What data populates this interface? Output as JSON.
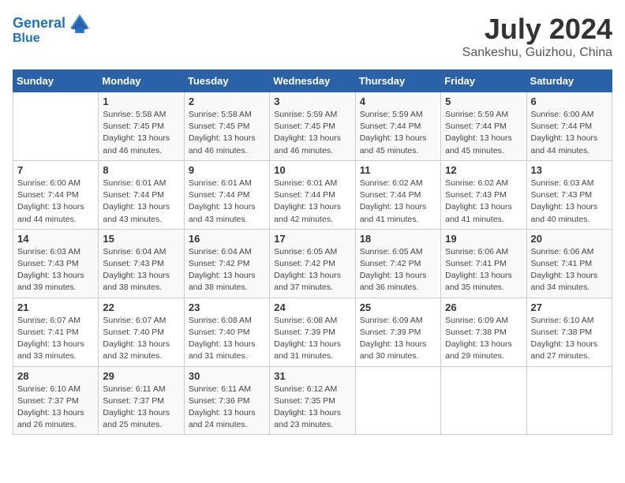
{
  "header": {
    "logo_line1": "General",
    "logo_line2": "Blue",
    "month_year": "July 2024",
    "location": "Sankeshu, Guizhou, China"
  },
  "weekdays": [
    "Sunday",
    "Monday",
    "Tuesday",
    "Wednesday",
    "Thursday",
    "Friday",
    "Saturday"
  ],
  "weeks": [
    [
      {
        "day": "",
        "info": ""
      },
      {
        "day": "1",
        "info": "Sunrise: 5:58 AM\nSunset: 7:45 PM\nDaylight: 13 hours\nand 46 minutes."
      },
      {
        "day": "2",
        "info": "Sunrise: 5:58 AM\nSunset: 7:45 PM\nDaylight: 13 hours\nand 46 minutes."
      },
      {
        "day": "3",
        "info": "Sunrise: 5:59 AM\nSunset: 7:45 PM\nDaylight: 13 hours\nand 46 minutes."
      },
      {
        "day": "4",
        "info": "Sunrise: 5:59 AM\nSunset: 7:44 PM\nDaylight: 13 hours\nand 45 minutes."
      },
      {
        "day": "5",
        "info": "Sunrise: 5:59 AM\nSunset: 7:44 PM\nDaylight: 13 hours\nand 45 minutes."
      },
      {
        "day": "6",
        "info": "Sunrise: 6:00 AM\nSunset: 7:44 PM\nDaylight: 13 hours\nand 44 minutes."
      }
    ],
    [
      {
        "day": "7",
        "info": "Sunrise: 6:00 AM\nSunset: 7:44 PM\nDaylight: 13 hours\nand 44 minutes."
      },
      {
        "day": "8",
        "info": "Sunrise: 6:01 AM\nSunset: 7:44 PM\nDaylight: 13 hours\nand 43 minutes."
      },
      {
        "day": "9",
        "info": "Sunrise: 6:01 AM\nSunset: 7:44 PM\nDaylight: 13 hours\nand 43 minutes."
      },
      {
        "day": "10",
        "info": "Sunrise: 6:01 AM\nSunset: 7:44 PM\nDaylight: 13 hours\nand 42 minutes."
      },
      {
        "day": "11",
        "info": "Sunrise: 6:02 AM\nSunset: 7:44 PM\nDaylight: 13 hours\nand 41 minutes."
      },
      {
        "day": "12",
        "info": "Sunrise: 6:02 AM\nSunset: 7:43 PM\nDaylight: 13 hours\nand 41 minutes."
      },
      {
        "day": "13",
        "info": "Sunrise: 6:03 AM\nSunset: 7:43 PM\nDaylight: 13 hours\nand 40 minutes."
      }
    ],
    [
      {
        "day": "14",
        "info": "Sunrise: 6:03 AM\nSunset: 7:43 PM\nDaylight: 13 hours\nand 39 minutes."
      },
      {
        "day": "15",
        "info": "Sunrise: 6:04 AM\nSunset: 7:43 PM\nDaylight: 13 hours\nand 38 minutes."
      },
      {
        "day": "16",
        "info": "Sunrise: 6:04 AM\nSunset: 7:42 PM\nDaylight: 13 hours\nand 38 minutes."
      },
      {
        "day": "17",
        "info": "Sunrise: 6:05 AM\nSunset: 7:42 PM\nDaylight: 13 hours\nand 37 minutes."
      },
      {
        "day": "18",
        "info": "Sunrise: 6:05 AM\nSunset: 7:42 PM\nDaylight: 13 hours\nand 36 minutes."
      },
      {
        "day": "19",
        "info": "Sunrise: 6:06 AM\nSunset: 7:41 PM\nDaylight: 13 hours\nand 35 minutes."
      },
      {
        "day": "20",
        "info": "Sunrise: 6:06 AM\nSunset: 7:41 PM\nDaylight: 13 hours\nand 34 minutes."
      }
    ],
    [
      {
        "day": "21",
        "info": "Sunrise: 6:07 AM\nSunset: 7:41 PM\nDaylight: 13 hours\nand 33 minutes."
      },
      {
        "day": "22",
        "info": "Sunrise: 6:07 AM\nSunset: 7:40 PM\nDaylight: 13 hours\nand 32 minutes."
      },
      {
        "day": "23",
        "info": "Sunrise: 6:08 AM\nSunset: 7:40 PM\nDaylight: 13 hours\nand 31 minutes."
      },
      {
        "day": "24",
        "info": "Sunrise: 6:08 AM\nSunset: 7:39 PM\nDaylight: 13 hours\nand 31 minutes."
      },
      {
        "day": "25",
        "info": "Sunrise: 6:09 AM\nSunset: 7:39 PM\nDaylight: 13 hours\nand 30 minutes."
      },
      {
        "day": "26",
        "info": "Sunrise: 6:09 AM\nSunset: 7:38 PM\nDaylight: 13 hours\nand 29 minutes."
      },
      {
        "day": "27",
        "info": "Sunrise: 6:10 AM\nSunset: 7:38 PM\nDaylight: 13 hours\nand 27 minutes."
      }
    ],
    [
      {
        "day": "28",
        "info": "Sunrise: 6:10 AM\nSunset: 7:37 PM\nDaylight: 13 hours\nand 26 minutes."
      },
      {
        "day": "29",
        "info": "Sunrise: 6:11 AM\nSunset: 7:37 PM\nDaylight: 13 hours\nand 25 minutes."
      },
      {
        "day": "30",
        "info": "Sunrise: 6:11 AM\nSunset: 7:36 PM\nDaylight: 13 hours\nand 24 minutes."
      },
      {
        "day": "31",
        "info": "Sunrise: 6:12 AM\nSunset: 7:35 PM\nDaylight: 13 hours\nand 23 minutes."
      },
      {
        "day": "",
        "info": ""
      },
      {
        "day": "",
        "info": ""
      },
      {
        "day": "",
        "info": ""
      }
    ]
  ]
}
